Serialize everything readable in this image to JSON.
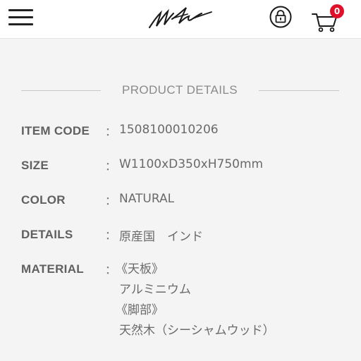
{
  "header": {
    "menu_icon": "hamburger-menu-icon",
    "logo_icon": "signature-logo",
    "lock_icon": "lock-icon",
    "cart_icon": "cart-icon",
    "cart_count": "0",
    "colors": {
      "badge": "#e0102b",
      "background": "#ffffff"
    }
  },
  "section": {
    "title": "PRODUCT DETAILS"
  },
  "details": {
    "separator": "：",
    "item_code": {
      "label": "ITEM CODE",
      "value": "1508100010206"
    },
    "size": {
      "label": "SIZE",
      "value": "W1100xD350xH750mm"
    },
    "color": {
      "label": "COLOR",
      "value": "NATURAL"
    },
    "details": {
      "label": "DETAILS",
      "value": "原産国　インド"
    },
    "material": {
      "label": "MATERIAL",
      "lines": [
        "《天板》",
        "アルミニウム",
        "《脚部》",
        "天然木（シーシャムウッド）"
      ]
    }
  }
}
